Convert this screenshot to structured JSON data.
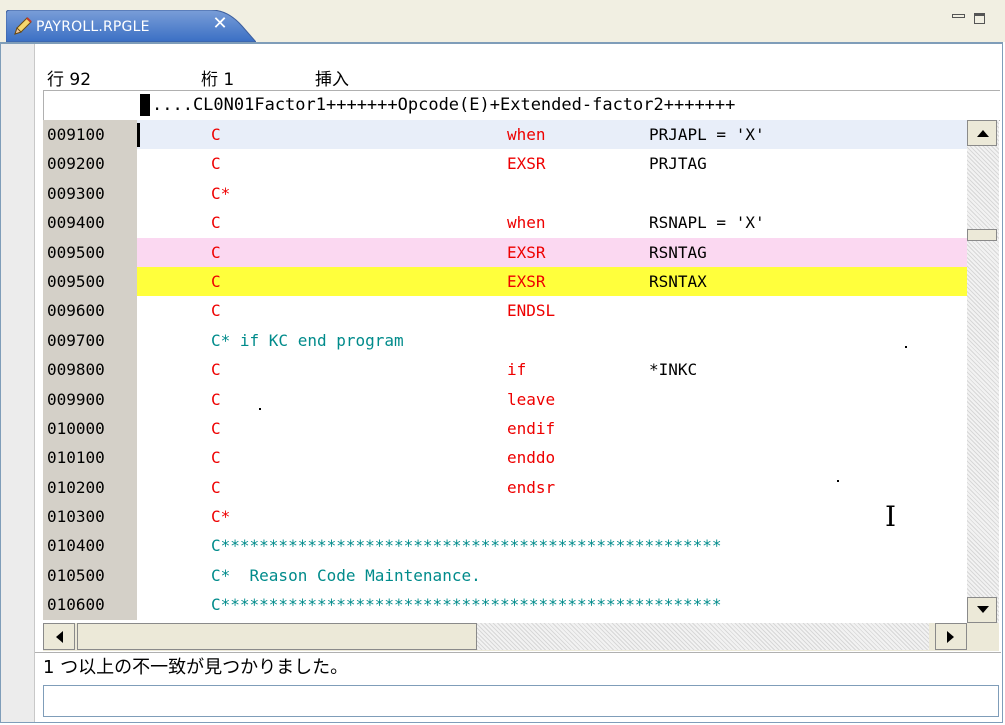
{
  "tab": {
    "title": "PAYROLL.RPGLE",
    "icon": "pencil-icon",
    "close": "✕"
  },
  "status": {
    "line_label": "行 92",
    "col_label": "桁 1",
    "mode_label": "挿入"
  },
  "ruler": "....CL0N01Factor1+++++++Opcode(E)+Extended-factor2+++++++",
  "lines": [
    {
      "num": "009100",
      "spec": "C",
      "op": "when",
      "f2": "PRJAPL = 'X'",
      "hl": "blue"
    },
    {
      "num": "009200",
      "spec": "C",
      "op": "EXSR",
      "f2": "PRJTAG",
      "hl": ""
    },
    {
      "num": "009300",
      "spec": "C*",
      "op": "",
      "f2": "",
      "hl": "",
      "comment": true
    },
    {
      "num": "009400",
      "spec": "C",
      "op": "when",
      "f2": "RSNAPL = 'X'",
      "hl": ""
    },
    {
      "num": "009500",
      "spec": "C",
      "op": "EXSR",
      "f2": "RSNTAG",
      "hl": "pink"
    },
    {
      "num": "009500",
      "spec": "C",
      "op": "EXSR",
      "f2": "RSNTAX",
      "hl": "yellow"
    },
    {
      "num": "009600",
      "spec": "C",
      "op": "ENDSL",
      "f2": "",
      "hl": ""
    },
    {
      "num": "009700",
      "spec": "C* if KC end program",
      "op": "",
      "f2": "",
      "hl": "",
      "comment": true
    },
    {
      "num": "009800",
      "spec": "C",
      "op": "if",
      "f2": "*INKC",
      "hl": ""
    },
    {
      "num": "009900",
      "spec": "C",
      "op": "leave",
      "f2": "",
      "hl": ""
    },
    {
      "num": "010000",
      "spec": "C",
      "op": "endif",
      "f2": "",
      "hl": ""
    },
    {
      "num": "010100",
      "spec": "C",
      "op": "enddo",
      "f2": "",
      "hl": ""
    },
    {
      "num": "010200",
      "spec": "C",
      "op": "endsr",
      "f2": "",
      "hl": ""
    },
    {
      "num": "010300",
      "spec": "C*",
      "op": "",
      "f2": "",
      "hl": "",
      "comment": true
    },
    {
      "num": "010400",
      "spec": "C****************************************************",
      "op": "",
      "f2": "",
      "hl": "",
      "comment": true
    },
    {
      "num": "010500",
      "spec": "C*  Reason Code Maintenance.",
      "op": "",
      "f2": "",
      "hl": "",
      "comment": true
    },
    {
      "num": "010600",
      "spec": "C****************************************************",
      "op": "",
      "f2": "",
      "hl": "",
      "comment": true
    }
  ],
  "message": "1 つ以上の不一致が見つかりました。",
  "command_value": "",
  "colors": {
    "opcode": "#ee0000",
    "comment": "#008b8b",
    "pink_highlight": "#fbd8f1",
    "yellow_highlight": "#ffff3c",
    "current_line": "#e8eef9"
  }
}
